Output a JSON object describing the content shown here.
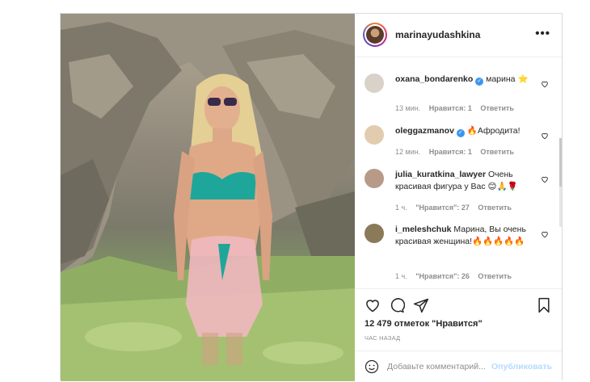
{
  "post": {
    "username": "marinayudashkina",
    "more_label": "•••"
  },
  "comments": [
    {
      "username": "oxana_bondarenko",
      "verified": true,
      "text": "марина ⭐",
      "time": "13 мин.",
      "likes": "Нравится: 1",
      "reply": "Ответить",
      "avatar_color": "#d8d2c8"
    },
    {
      "username": "oleggazmanov",
      "verified": true,
      "text": "🔥Афродита!",
      "time": "12 мин.",
      "likes": "Нравится: 1",
      "reply": "Ответить",
      "avatar_color": "#e2ccb0"
    },
    {
      "username": "julia_kuratkina_lawyer",
      "verified": false,
      "text": "Очень красивая фигура у Вас 😊🙏🌹",
      "time": "1 ч.",
      "likes": "\"Нравится\": 27",
      "reply": "Ответить",
      "avatar_color": "#b89a88"
    },
    {
      "username": "i_meleshchuk",
      "verified": false,
      "text": "Марина, Вы очень красивая женщина!🔥🔥🔥🔥🔥",
      "time": "1 ч.",
      "likes": "\"Нравится\": 26",
      "reply": "Ответить",
      "avatar_color": "#8a7a5a"
    }
  ],
  "actions": {
    "likes_count": "12 479 отметок \"Нравится\"",
    "time_ago": "ЧАС НАЗАД"
  },
  "add_comment": {
    "placeholder": "Добавьте комментарий...",
    "publish_label": "Опубликовать"
  },
  "colors": {
    "verified": "#3897f0",
    "publish_disabled": "#b3dbff",
    "muted": "#8e8e8e"
  }
}
